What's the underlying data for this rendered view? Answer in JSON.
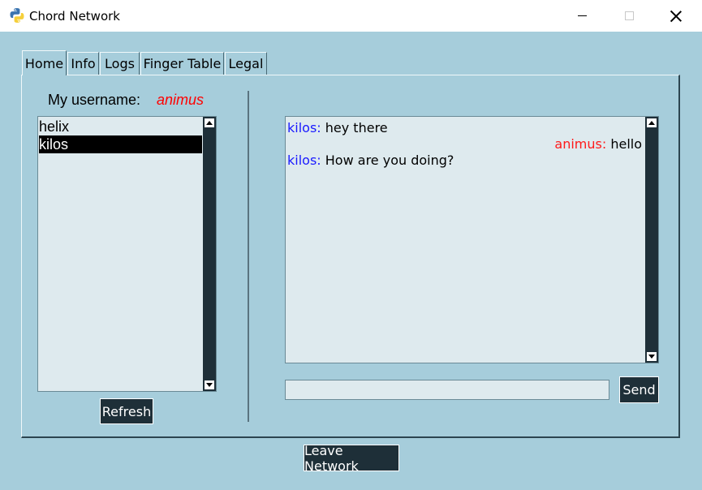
{
  "window": {
    "title": "Chord Network"
  },
  "tabs": [
    "Home",
    "Info",
    "Logs",
    "Finger Table",
    "Legal"
  ],
  "profile": {
    "label": "My username:",
    "username": "animus"
  },
  "users": [
    "helix",
    "kilos"
  ],
  "selected_user": "kilos",
  "buttons": {
    "refresh": "Refresh",
    "send": "Send",
    "leave": "Leave Network"
  },
  "messages": [
    {
      "sender": "kilos",
      "text": "hey there",
      "own": false
    },
    {
      "sender": "animus",
      "text": "hello",
      "own": true
    },
    {
      "sender": "kilos",
      "text": "How are you doing?",
      "own": false
    }
  ],
  "message_input": {
    "value": ""
  },
  "colors": {
    "background": "#a6cddb",
    "list_bg": "#deeaee",
    "button_bg": "#1e2f38",
    "self_name": "#ff1a1a",
    "peer_name": "#1a1aff"
  },
  "icons": {
    "app": "python-icon"
  }
}
